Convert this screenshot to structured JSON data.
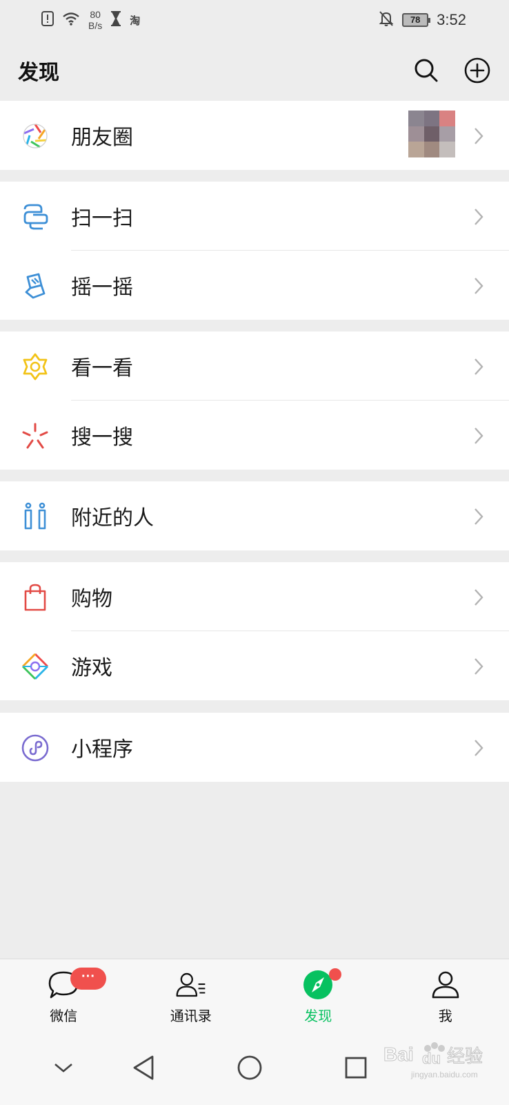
{
  "status_bar": {
    "net_speed": "80",
    "net_unit": "B/s",
    "taobao_glyph": "淘",
    "battery": "78",
    "time": "3:52"
  },
  "header": {
    "title": "发现",
    "search_icon": "search-icon",
    "add_icon": "plus-circle-icon"
  },
  "menu_groups": [
    {
      "items": [
        {
          "label": "朋友圈",
          "icon": "moments-shutter-icon"
        }
      ]
    },
    {
      "items": [
        {
          "label": "扫一扫",
          "icon": "scan-icon"
        },
        {
          "label": "摇一摇",
          "icon": "shake-icon"
        }
      ]
    },
    {
      "items": [
        {
          "label": "看一看",
          "icon": "top-stories-icon"
        },
        {
          "label": "搜一搜",
          "icon": "search-spark-icon"
        }
      ]
    },
    {
      "items": [
        {
          "label": "附近的人",
          "icon": "people-nearby-icon"
        }
      ]
    },
    {
      "items": [
        {
          "label": "购物",
          "icon": "shopping-bag-icon"
        },
        {
          "label": "游戏",
          "icon": "games-diamond-icon"
        }
      ]
    },
    {
      "items": [
        {
          "label": "小程序",
          "icon": "mini-program-icon"
        }
      ]
    }
  ],
  "tabs": [
    {
      "label": "微信",
      "icon": "chat-bubble-icon",
      "badge": "···"
    },
    {
      "label": "通讯录",
      "icon": "contacts-icon"
    },
    {
      "label": "发现",
      "icon": "discover-compass-icon",
      "active": true
    },
    {
      "label": "我",
      "icon": "me-person-icon"
    }
  ],
  "colors": {
    "accent": "#07c160",
    "badge": "#f0504d",
    "background": "#ededed"
  },
  "watermark": {
    "text": "Bai 经验",
    "sub": "jingyan.baidu.com"
  }
}
